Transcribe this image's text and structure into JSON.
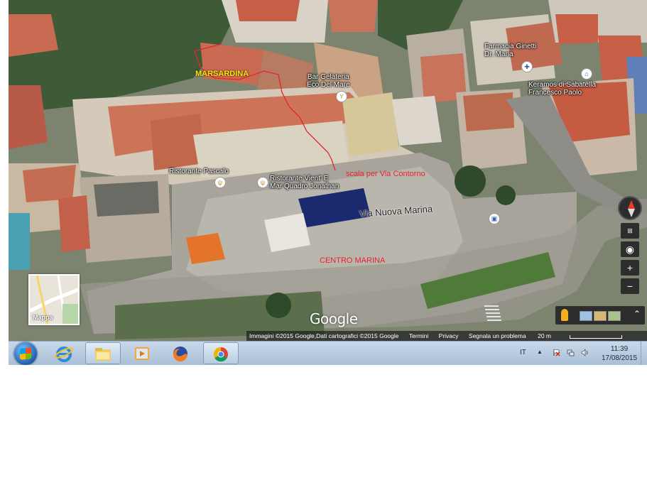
{
  "map": {
    "places": {
      "farmacia": "Farmacia Ginetti\nDr. Maria",
      "keramos": "Keramos di Sabatella\nFrancesco Paolo",
      "bar": "Bar Gelateria\nEco Del Mare",
      "ristorante_pascalo": "Ristorante Pascalo",
      "ristorante_vientemar": "Ristorante Vient' E\nMar Quadro Jonathan"
    },
    "annotations": {
      "marsardina": "MARSARDINA",
      "scala": "scala per Via Contorno",
      "centro_marina": "CENTRO MARINA"
    },
    "street_name": "Via Nuova Marina",
    "logo": "Google",
    "attribution": {
      "imagery": "Immagini ©2015 Google,Dati cartografici ©2015 Google",
      "terms": "Termini",
      "privacy": "Privacy",
      "report": "Segnala un problema",
      "scale": "20 m"
    },
    "minimap_label": "Mappa",
    "controls": {
      "zoom_in": "+",
      "zoom_out": "−"
    },
    "colors": {
      "annotation_red": "#e8232b",
      "annotation_yellow": "#ffe600"
    }
  },
  "taskbar": {
    "apps": [
      "start-icon",
      "internet-explorer-icon",
      "file-explorer-icon",
      "media-player-icon",
      "firefox-icon",
      "chrome-icon"
    ],
    "language": "IT",
    "time": "11:39",
    "date": "17/08/2015"
  }
}
